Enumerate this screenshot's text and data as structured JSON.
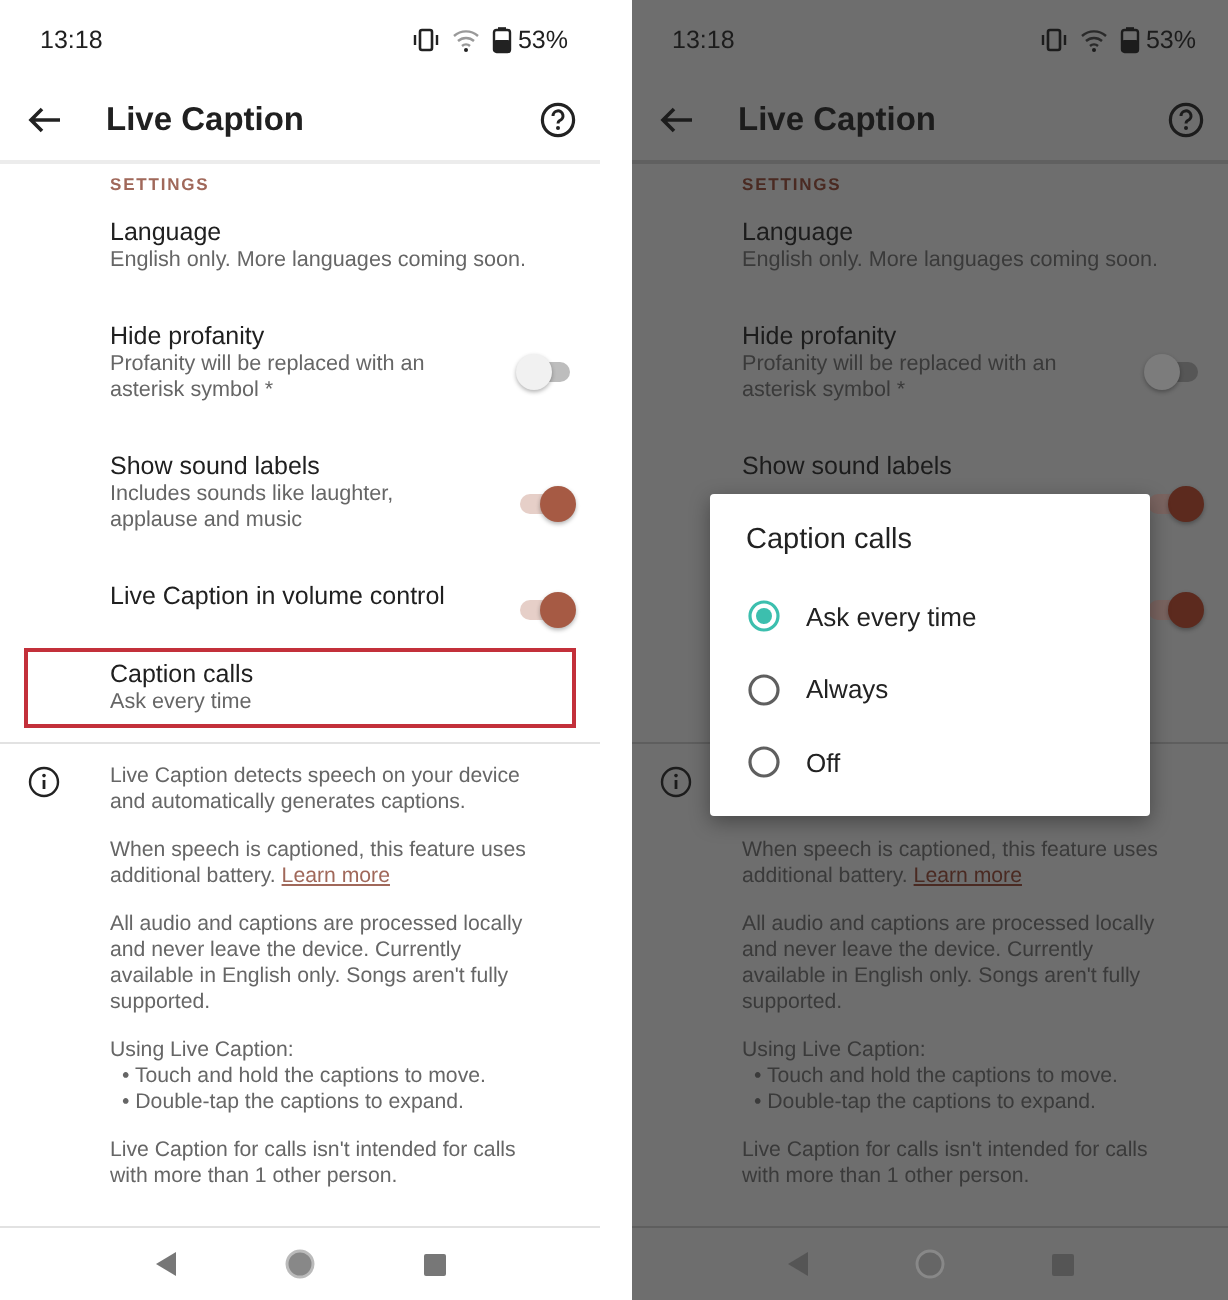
{
  "screens": [
    {
      "dimmed": false,
      "status_bar": {
        "time": "13:18",
        "battery": "53%"
      },
      "title": "Live Caption",
      "section_header": "SETTINGS",
      "settings": [
        {
          "kind": "plain",
          "title": "Language",
          "subtitle": "English only. More languages coming soon.",
          "highlighted": false
        },
        {
          "kind": "toggle",
          "title": "Hide profanity",
          "subtitle": "Profanity will be replaced with an asterisk symbol *",
          "on": false,
          "highlighted": false
        },
        {
          "kind": "toggle",
          "title": "Show sound labels",
          "subtitle": "Includes sounds like laughter, applause and music",
          "on": true,
          "highlighted": false
        },
        {
          "kind": "toggle",
          "title": "Live Caption in volume control",
          "on": true,
          "highlighted": false
        },
        {
          "kind": "plain",
          "title": "Caption calls",
          "subtitle": "Ask every time",
          "highlighted": true
        }
      ],
      "info": [
        {
          "kind": "paragraph",
          "text": "Live Caption detects speech on your device and automatically generates captions."
        },
        {
          "kind": "paragraph",
          "text": "When speech is captioned, this feature uses additional battery.",
          "link": "Learn more"
        },
        {
          "kind": "paragraph",
          "text": "All audio and captions are processed locally and never leave the device. Currently available in English only. Songs aren't fully supported."
        },
        {
          "kind": "list",
          "heading": "Using Live Caption:",
          "items": [
            "• Touch and hold the captions to move.",
            "• Double-tap the captions to expand."
          ]
        },
        {
          "kind": "paragraph",
          "text": "Live Caption for calls isn't intended for calls with more than 1 other person."
        }
      ]
    },
    {
      "dimmed": true,
      "status_bar": {
        "time": "13:18",
        "battery": "53%"
      },
      "title": "Live Caption",
      "section_header": "SETTINGS",
      "settings": [
        {
          "kind": "plain",
          "title": "Language",
          "subtitle": "English only. More languages coming soon.",
          "highlighted": false
        },
        {
          "kind": "toggle",
          "title": "Hide profanity",
          "subtitle": "Profanity will be replaced with an asterisk symbol *",
          "on": false,
          "highlighted": false
        },
        {
          "kind": "toggle",
          "title": "Show sound labels",
          "on": true,
          "highlighted": false
        },
        {
          "kind": "toggle",
          "on": true,
          "highlighted": false
        },
        {
          "kind": "covered"
        }
      ],
      "info": [
        {
          "kind": "covered"
        },
        {
          "kind": "paragraph",
          "text": "When speech is captioned, this feature uses additional battery.",
          "link": "Learn more"
        },
        {
          "kind": "paragraph",
          "text": "All audio and captions are processed locally and never leave the device. Currently available in English only. Songs aren't fully supported."
        },
        {
          "kind": "list",
          "heading": "Using Live Caption:",
          "items": [
            "• Touch and hold the captions to move.",
            "• Double-tap the captions to expand."
          ]
        },
        {
          "kind": "paragraph",
          "text": "Live Caption for calls isn't intended for calls with more than 1 other person."
        }
      ],
      "dialog": {
        "title": "Caption calls",
        "options": [
          {
            "label": "Ask every time",
            "selected": true
          },
          {
            "label": "Always",
            "selected": false
          },
          {
            "label": "Off",
            "selected": false
          }
        ]
      }
    }
  ]
}
